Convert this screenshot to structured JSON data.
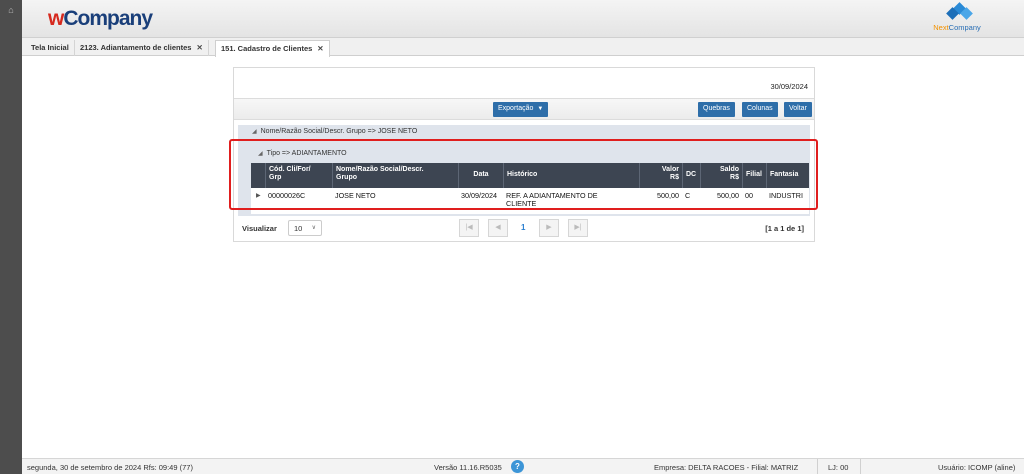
{
  "app": {
    "logo_w": "w",
    "logo_rest": "Company",
    "brand_next": "Next",
    "brand_company": "Company"
  },
  "tabs": [
    {
      "label": "Tela Inicial",
      "closable": false
    },
    {
      "label": "2123. Adiantamento de clientes",
      "closable": true
    },
    {
      "label": "151. Cadastro de Clientes",
      "closable": true,
      "active": true
    }
  ],
  "report": {
    "date": "30/09/2024",
    "export_label": "Exportação",
    "buttons": {
      "quebras": "Quebras",
      "colunas": "Colunas",
      "voltar": "Voltar"
    },
    "group1": "Nome/Razão Social/Descr. Grupo => JOSE NETO",
    "group2": "Tipo => ADIANTAMENTO",
    "columns": {
      "cod": [
        "Cód. Cli/For/",
        "Grp"
      ],
      "nome": [
        "Nome/Razão Social/Descr.",
        "Grupo"
      ],
      "data": "Data",
      "historico": "Histórico",
      "valor": [
        "Valor",
        "R$"
      ],
      "dc": "DC",
      "saldo": [
        "Saldo",
        "R$"
      ],
      "filial": "Filial",
      "fantasia": "Fantasia"
    },
    "row": {
      "cod": "00000026C",
      "nome": "JOSE NETO",
      "data": "30/09/2024",
      "historico": [
        "REF. A ADIANTAMENTO DE",
        "CLIENTE"
      ],
      "valor": "500,00",
      "dc": "C",
      "saldo": "500,00",
      "filial": "00",
      "fantasia": "INDUSTRI"
    },
    "pager": {
      "visualizar": "Visualizar",
      "page_size": "10",
      "current_page": "1",
      "info": "[1 a 1 de 1]"
    }
  },
  "footer": {
    "datetime": "segunda, 30 de setembro de 2024  Rfs: 09:49 (77)",
    "version": "Versão 11.16.R5035",
    "help": "?",
    "empresa": "Empresa: DELTA RACOES - Filial: MATRIZ",
    "lj": "LJ: 00",
    "usuario": "Usuário: ICOMP (aline)"
  },
  "colors": {
    "accent": "#2e6ea9",
    "header_dark": "#3d4552",
    "highlight": "#e01e1e"
  }
}
